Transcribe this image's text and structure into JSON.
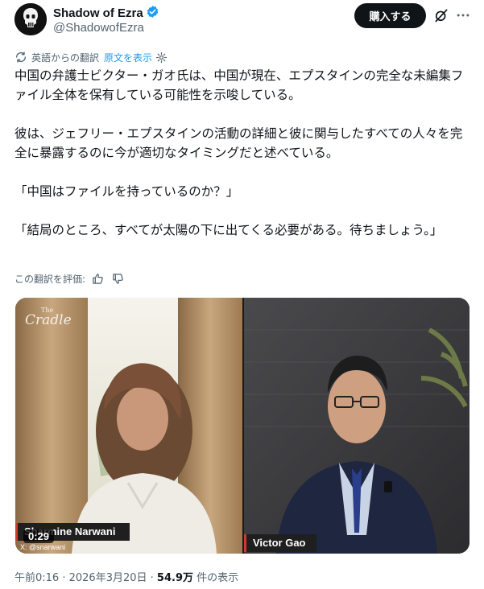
{
  "author": {
    "name": "Shadow of Ezra",
    "handle": "@ShadowofEzra"
  },
  "actions": {
    "buy_label": "購入する"
  },
  "translation": {
    "note": "英語からの翻訳",
    "show_original": "原文を表示"
  },
  "post": {
    "paragraphs": [
      "中国の弁護士ビクター・ガオ氏は、中国が現在、エプスタインの完全な未編集ファイル全体を保有している可能性を示唆している。",
      "彼は、ジェフリー・エプスタインの活動の詳細と彼に関与したすべての人々を完全に暴露するのに今が適切なタイミングだと述べている。",
      "「中国はファイルを持っているのか？」",
      "「結局のところ、すべてが太陽の下に出てくる必要がある。待ちましょう。」"
    ]
  },
  "rating": {
    "label": "この翻訳を評価:"
  },
  "video": {
    "logo_the": "The",
    "logo_name": "Cradle",
    "left_name": "Sharmine Narwani",
    "right_name": "Victor Gao",
    "elapsed": "0:29",
    "credit": "X: @snarwani"
  },
  "meta": {
    "time": "午前0:16",
    "date": "2026年3月20日",
    "views": "54.9万",
    "views_suffix": "件の表示"
  },
  "colors": {
    "accent": "#1d9bf0",
    "name_tag_bar": "#d33a2c"
  }
}
